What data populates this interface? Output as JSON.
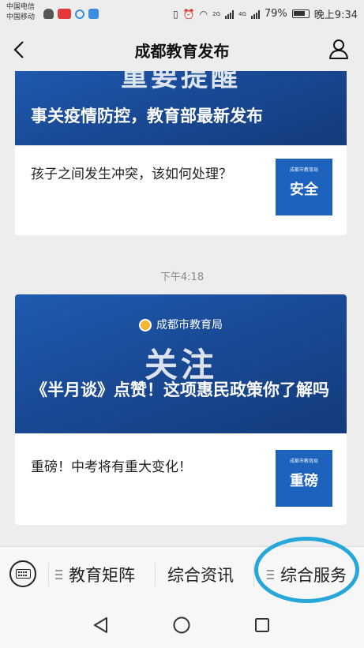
{
  "status_bar": {
    "carrier_1": "中国电信",
    "carrier_2": "中国移动",
    "network_1": "2G",
    "network_2": "4G",
    "battery_percent": "79%",
    "time": "晚上9:34"
  },
  "header": {
    "title": "成都教育发布"
  },
  "articles": [
    {
      "banner_word": "重要提醒",
      "headline": "事关疫情防控，教育部最新发布",
      "sub_text": "孩子之间发生冲突，该如何处理？",
      "thumb_org": "成都市教育局",
      "thumb_word": "安全"
    },
    {
      "time": "下午4:18",
      "org": "成都市教育局",
      "banner_word": "关注",
      "headline": "《半月谈》点赞！这项惠民政策你了解吗",
      "sub_text": "重磅！中考将有重大变化！",
      "thumb_org": "成都市教育局",
      "thumb_word": "重磅"
    }
  ],
  "bottom_menu": {
    "items": [
      {
        "label": "教育矩阵",
        "has_submenu": true
      },
      {
        "label": "综合资讯",
        "has_submenu": false
      },
      {
        "label": "综合服务",
        "has_submenu": true
      }
    ]
  },
  "colors": {
    "banner_blue": "#1a4a96",
    "thumb_blue": "#1d63bd",
    "highlight_ring": "#27a7d9"
  }
}
